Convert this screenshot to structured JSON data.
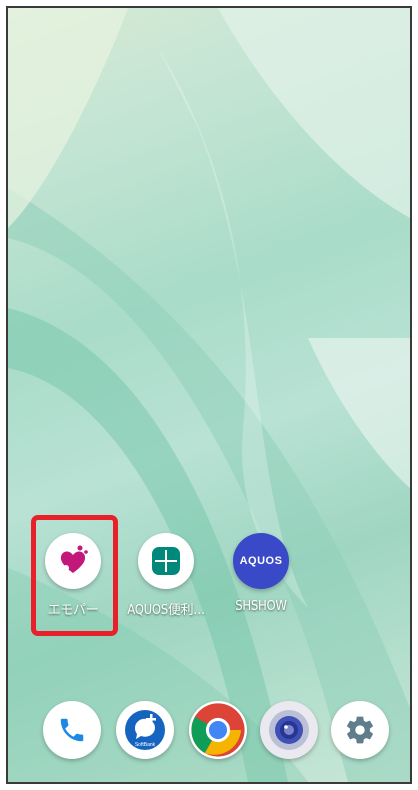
{
  "home_apps": [
    {
      "label": "エモパー",
      "icon": "emopa-heart-icon",
      "color": "#c2187a"
    },
    {
      "label": "AQUOS便利…",
      "icon": "grid-icon",
      "color": "#00897b"
    },
    {
      "label": "SHSHOW",
      "icon": "aquos-icon",
      "icon_text": "AQUOS",
      "color": "#3949c8"
    }
  ],
  "dock": [
    {
      "icon": "phone-icon",
      "color": "#1e88e5"
    },
    {
      "icon": "softbank-message-icon",
      "icon_text": "SoftBank",
      "color": "#1565c0"
    },
    {
      "icon": "chrome-icon"
    },
    {
      "icon": "camera-icon",
      "color": "#3f51b5"
    },
    {
      "icon": "settings-icon",
      "color": "#607d8b"
    }
  ],
  "colors": {
    "highlight": "#e8202a",
    "wallpaper": "#a9dcc9"
  }
}
